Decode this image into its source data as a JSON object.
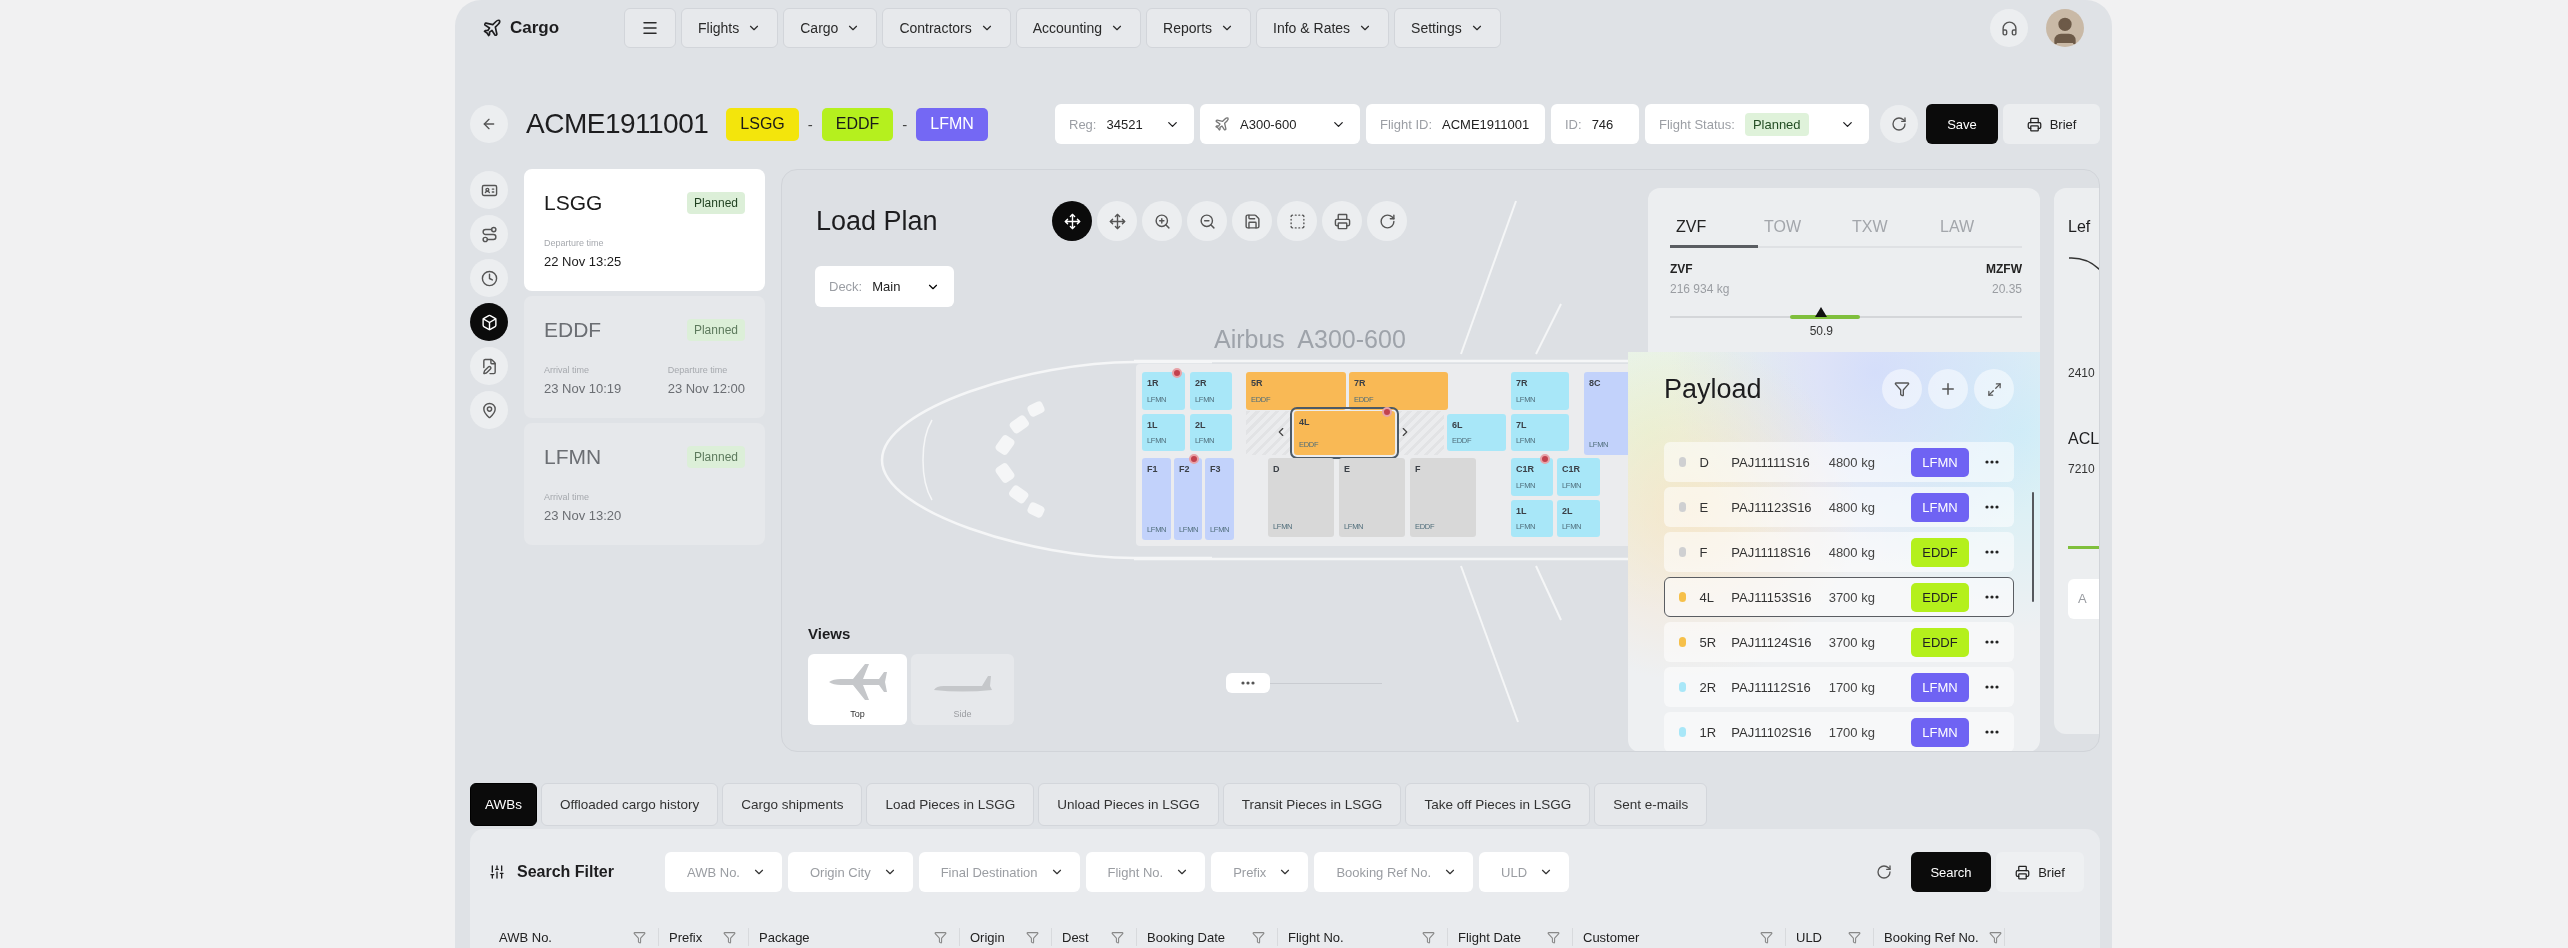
{
  "app": {
    "name": "Cargo"
  },
  "nav": {
    "items": [
      {
        "label": "Flights"
      },
      {
        "label": "Cargo"
      },
      {
        "label": "Contractors"
      },
      {
        "label": "Accounting"
      },
      {
        "label": "Reports"
      },
      {
        "label": "Info & Rates"
      },
      {
        "label": "Settings"
      }
    ]
  },
  "flight": {
    "code": "ACME1911001",
    "route": [
      {
        "code": "LSGG",
        "color": "#f3e50c"
      },
      {
        "code": "EDDF",
        "color": "#b5f01e"
      },
      {
        "code": "LFMN",
        "color": "#7468f4"
      }
    ],
    "separators": [
      "-",
      "-"
    ]
  },
  "fields": [
    {
      "kind": "select",
      "label": "Reg:",
      "value": "34521"
    },
    {
      "kind": "aircraft",
      "value": "A300-600"
    },
    {
      "kind": "text",
      "label": "Flight ID:",
      "value": "ACME1911001"
    },
    {
      "kind": "text",
      "label": "ID:",
      "value": "746"
    },
    {
      "kind": "status",
      "label": "Flight Status:",
      "value": "Planned"
    }
  ],
  "actions": {
    "save": "Save",
    "brief": "Brief"
  },
  "side_tools": [
    {
      "selected": false
    },
    {
      "selected": false
    },
    {
      "selected": false
    },
    {
      "selected": true
    },
    {
      "selected": false
    },
    {
      "selected": false
    }
  ],
  "stops": [
    {
      "code": "LSGG",
      "status": "Planned",
      "selected": true,
      "times": [
        {
          "label": "Departure time",
          "value": "22 Nov 13:25"
        }
      ]
    },
    {
      "code": "EDDF",
      "status": "Planned",
      "selected": false,
      "times": [
        {
          "label": "Arrival time",
          "value": "23 Nov 10:19"
        },
        {
          "label": "Departure time",
          "value": "23 Nov 12:00"
        }
      ]
    },
    {
      "code": "LFMN",
      "status": "Planned",
      "selected": false,
      "times": [
        {
          "label": "Arrival time",
          "value": "23 Nov 13:20"
        }
      ]
    }
  ],
  "load_plan": {
    "title": "Load Plan",
    "tools": [
      {
        "selected": true
      },
      {
        "selected": false
      },
      {
        "selected": false
      },
      {
        "selected": false
      },
      {
        "selected": false
      },
      {
        "selected": false
      },
      {
        "selected": false
      },
      {
        "selected": false
      }
    ],
    "deck": {
      "label": "Deck:",
      "value": "Main"
    },
    "aircraft": "Airbus  A300-600",
    "ulds": [
      {
        "label": "1R",
        "dest": "LFMN",
        "color": "#a8e7f8",
        "alert": true,
        "selected": false
      },
      {
        "label": "2R",
        "dest": "LFMN",
        "color": "#a8e7f8",
        "alert": false,
        "selected": false
      },
      {
        "label": "5R",
        "dest": "EDDF",
        "color": "#f9b955",
        "alert": false,
        "selected": false
      },
      {
        "label": "7R",
        "dest": "EDDF",
        "color": "#f9b955",
        "alert": false,
        "selected": false
      },
      {
        "label": "1L",
        "dest": "LFMN",
        "color": "#a8e7f8",
        "alert": false,
        "selected": false
      },
      {
        "label": "2L",
        "dest": "LFMN",
        "color": "#a8e7f8",
        "alert": false,
        "selected": false
      },
      {
        "label": "4L",
        "dest": "EDDF",
        "color": "#f9b955",
        "alert": true,
        "selected": true
      },
      {
        "label": "6L",
        "dest": "EDDF",
        "color": "#a8e7f8",
        "alert": false,
        "selected": false
      },
      {
        "label": "7R",
        "dest": "LFMN",
        "color": "#a8e7f8",
        "alert": false,
        "selected": false
      },
      {
        "label": "7L",
        "dest": "LFMN",
        "color": "#a8e7f8",
        "alert": false,
        "selected": false
      },
      {
        "label": "8C",
        "dest": "LFMN",
        "color": "#c2d2fb",
        "alert": false,
        "selected": false
      },
      {
        "label": "F1",
        "dest": "LFMN",
        "color": "#c2d2fb",
        "alert": false,
        "selected": false
      },
      {
        "label": "F2",
        "dest": "LFMN",
        "color": "#c2d2fb",
        "alert": true,
        "selected": false
      },
      {
        "label": "F3",
        "dest": "LFMN",
        "color": "#c2d2fb",
        "alert": false,
        "selected": false
      },
      {
        "label": "D",
        "dest": "LFMN",
        "color": "#d8d8d8",
        "alert": false,
        "selected": false
      },
      {
        "label": "E",
        "dest": "LFMN",
        "color": "#d8d8d8",
        "alert": false,
        "selected": false
      },
      {
        "label": "F",
        "dest": "EDDF",
        "color": "#d8d8d8",
        "alert": false,
        "selected": false
      },
      {
        "label": "C1R",
        "dest": "LFMN",
        "color": "#a8e7f8",
        "alert": true,
        "selected": false
      },
      {
        "label": "C1R",
        "dest": "LFMN",
        "color": "#a8e7f8",
        "alert": false,
        "selected": false
      },
      {
        "label": "1L",
        "dest": "LFMN",
        "color": "#a8e7f8",
        "alert": false,
        "selected": false
      },
      {
        "label": "2L",
        "dest": "LFMN",
        "color": "#a8e7f8",
        "alert": false,
        "selected": false
      }
    ],
    "views": {
      "title": "Views",
      "items": [
        {
          "label": "Top",
          "selected": true
        },
        {
          "label": "Side",
          "selected": false
        }
      ]
    }
  },
  "weights": {
    "tabs": [
      {
        "label": "ZVF",
        "selected": true
      },
      {
        "label": "TOW",
        "selected": false
      },
      {
        "label": "TXW",
        "selected": false
      },
      {
        "label": "LAW",
        "selected": false
      }
    ],
    "left": {
      "label": "ZVF",
      "value": "216 934 kg"
    },
    "right": {
      "label": "MZFW",
      "value": "20.35"
    },
    "balance": {
      "level": 0.43,
      "reading": "50.9"
    }
  },
  "payload": {
    "title": "Payload",
    "rows": [
      {
        "position": "D",
        "id": "PAJ11111S16",
        "weight": "4800 kg",
        "badge": {
          "text": "LFMN",
          "color": "#6f63f3"
        },
        "color": "#cfd0d2",
        "selected": false
      },
      {
        "position": "E",
        "id": "PAJ11123S16",
        "weight": "4800 kg",
        "badge": {
          "text": "LFMN",
          "color": "#6f63f3"
        },
        "color": "#cfd0d2",
        "selected": false
      },
      {
        "position": "F",
        "id": "PAJ11118S16",
        "weight": "4800 kg",
        "badge": {
          "text": "EDDF",
          "color": "#b4f01c"
        },
        "color": "#cfd0d2",
        "selected": false
      },
      {
        "position": "4L",
        "id": "PAJ11153S16",
        "weight": "3700 kg",
        "badge": {
          "text": "EDDF",
          "color": "#b4f01c"
        },
        "color": "#f6c04a",
        "selected": true
      },
      {
        "position": "5R",
        "id": "PAJ11124S16",
        "weight": "3700 kg",
        "badge": {
          "text": "EDDF",
          "color": "#b4f01c"
        },
        "color": "#f6c04a",
        "selected": false
      },
      {
        "position": "2R",
        "id": "PAJ11112S16",
        "weight": "1700 kg",
        "badge": {
          "text": "LFMN",
          "color": "#6f63f3"
        },
        "color": "#a8e7f8",
        "selected": false
      },
      {
        "position": "1R",
        "id": "PAJ11102S16",
        "weight": "1700 kg",
        "badge": {
          "text": "LFMN",
          "color": "#6f63f3"
        },
        "color": "#a8e7f8",
        "selected": false
      }
    ]
  },
  "side_panel": {
    "title": "Lef",
    "value": "2410",
    "acl": "ACL",
    "acl_value": "7210",
    "field": "A"
  },
  "bottom_tabs": [
    {
      "label": "AWBs",
      "selected": true
    },
    {
      "label": "Offloaded cargo history",
      "selected": false
    },
    {
      "label": "Cargo shipments",
      "selected": false
    },
    {
      "label": "Load Pieces in LSGG",
      "selected": false
    },
    {
      "label": "Unload Pieces in LSGG",
      "selected": false
    },
    {
      "label": "Transit Pieces in LSGG",
      "selected": false
    },
    {
      "label": "Take off Pieces in LSGG",
      "selected": false
    },
    {
      "label": "Sent e-mails",
      "selected": false
    }
  ],
  "filter": {
    "title": "Search Filter",
    "dropdowns": [
      "AWB No.",
      "Origin City",
      "Final Destination",
      "Flight No.",
      "Prefix",
      "Booking Ref No.",
      "ULD"
    ],
    "search": "Search",
    "brief": "Brief"
  },
  "table": {
    "columns": [
      "AWB No.",
      "Prefix",
      "Package",
      "Origin",
      "Dest",
      "Booking Date",
      "Flight No.",
      "Flight Date",
      "Customer",
      "ULD",
      "Booking Ref No."
    ]
  }
}
